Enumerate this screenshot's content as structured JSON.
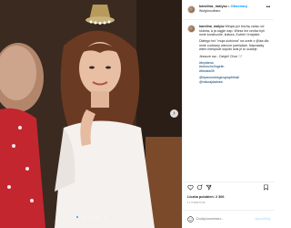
{
  "post": {
    "username": "karolina_malysz",
    "separator": "•",
    "follow_label": "Obserwuj",
    "location": "Wolghnouflubo",
    "more_label": "•••"
  },
  "caption": {
    "username": "karolina_malysz",
    "paragraph1": "Minęło już trochę czasu od ślubów, a ja ciągle wsp. Wiesz też cenisz byli mnie koniecznie, kultura, Kobiet i Irrajdzie.",
    "paragraph2": "Dlatego też \"moja ulubiona\" na czele z @isa dla mnie cudowny wieczór pamiętam. Naprawdę wiem mielęście dopóki dziś je to ocaleje.",
    "paragraph3": "Jeszcze raz - Dzięki! Choć 🤍",
    "hashtags": [
      "#bryllama",
      "#stroncho3ngelin",
      "#theaks05"
    ],
    "mentions": [
      "@bysnooslesgeograpihfusil",
      "@mikoajdadraw"
    ]
  },
  "stats": {
    "likes": "Liczba polubień: 2 306",
    "date": "17 KWIETNIA"
  },
  "comment": {
    "placeholder": "Dodaj komentarz...",
    "post_label": "Opublikuj"
  },
  "photo": {
    "slide_count": 5,
    "active_slide": 0
  },
  "colors": {
    "link_blue": "#0095f6",
    "hashtag_blue": "#00376b",
    "text": "#262626",
    "muted": "#8e8e8e",
    "border": "#efefef"
  },
  "icons": {
    "photo_next": "chevron-right-icon",
    "like": "heart-icon",
    "comment": "comment-icon",
    "share": "share-icon",
    "save": "bookmark-icon",
    "emoji": "emoji-icon"
  }
}
